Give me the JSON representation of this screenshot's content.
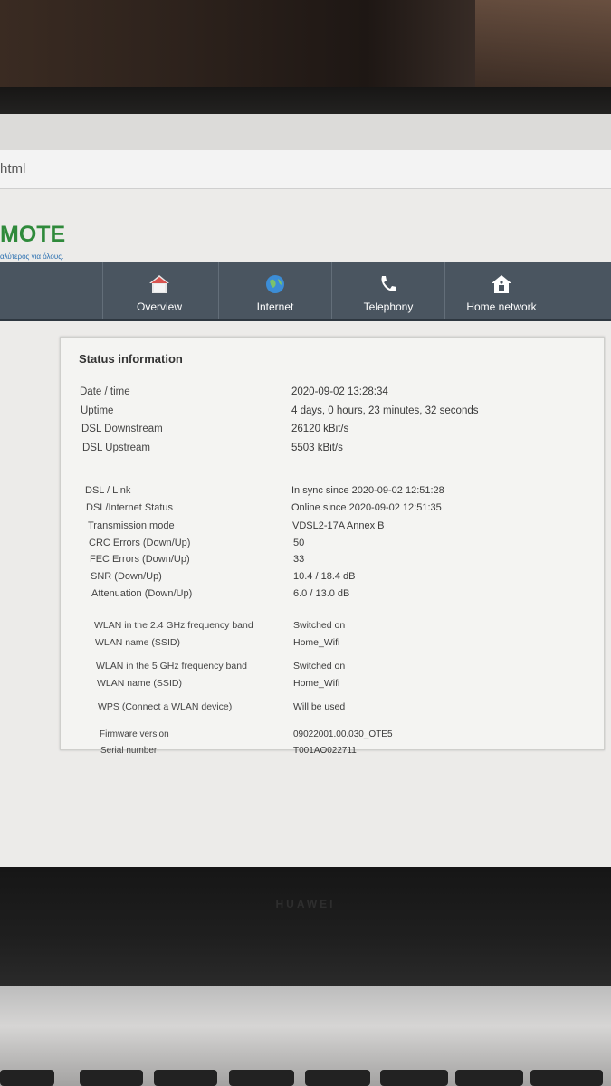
{
  "browser": {
    "url_fragment": "html"
  },
  "router": {
    "logo": "MOTE",
    "logo_tagline": "αλύτερος για όλους."
  },
  "nav": {
    "items": [
      {
        "label": "Overview",
        "icon": "home-icon"
      },
      {
        "label": "Internet",
        "icon": "globe-icon"
      },
      {
        "label": "Telephony",
        "icon": "phone-icon"
      },
      {
        "label": "Home network",
        "icon": "house-network-icon"
      }
    ]
  },
  "status": {
    "title": "Status information",
    "general": [
      {
        "label": "Date / time",
        "value": "2020-09-02 13:28:34"
      },
      {
        "label": "Uptime",
        "value": "4 days, 0 hours, 23 minutes, 32 seconds"
      },
      {
        "label": "DSL Downstream",
        "value": "26120 kBit/s"
      },
      {
        "label": "DSL Upstream",
        "value": "5503 kBit/s"
      }
    ],
    "dsl": [
      {
        "label": "DSL / Link",
        "value": "In sync since 2020-09-02 12:51:28"
      },
      {
        "label": "DSL/Internet Status",
        "value": "Online since 2020-09-02 12:51:35"
      },
      {
        "label": "Transmission mode",
        "value": "VDSL2-17A Annex B"
      },
      {
        "label": "CRC Errors (Down/Up)",
        "value": "50"
      },
      {
        "label": "FEC Errors (Down/Up)",
        "value": "33"
      },
      {
        "label": "SNR (Down/Up)",
        "value": "10.4 / 18.4 dB"
      },
      {
        "label": "Attenuation (Down/Up)",
        "value": "6.0 / 13.0 dB"
      }
    ],
    "wlan": [
      {
        "label": "WLAN in the 2.4 GHz frequency band",
        "value": "Switched on"
      },
      {
        "label": "WLAN name (SSID)",
        "value": "Home_Wifi"
      },
      {
        "label": "WLAN in the 5 GHz frequency band",
        "value": "Switched on"
      },
      {
        "label": "WLAN name (SSID)",
        "value": "Home_Wifi"
      },
      {
        "label": "WPS (Connect a WLAN device)",
        "value": "Will be used"
      }
    ],
    "device": [
      {
        "label": "Firmware version",
        "value": "09022001.00.030_OTE5"
      },
      {
        "label": "Serial number",
        "value": "T001AO022711"
      }
    ]
  },
  "hardware": {
    "brand": "HUAWEI"
  },
  "colors": {
    "navbar": "#4a5560",
    "logo_green": "#2f8a3b",
    "logo_blue": "#2a6fb0"
  }
}
